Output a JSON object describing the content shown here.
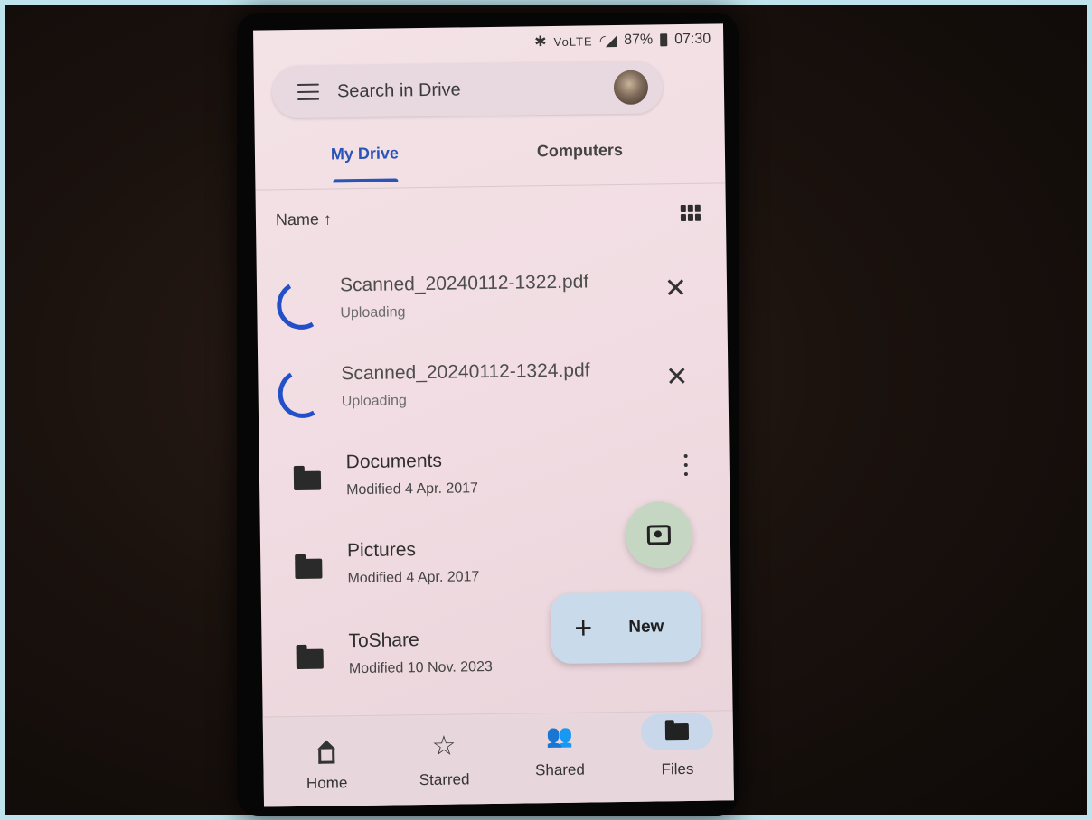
{
  "status_bar": {
    "network": "VoLTE",
    "battery": "87%",
    "time": "07:30"
  },
  "search": {
    "placeholder": "Search in Drive"
  },
  "tabs": [
    {
      "label": "My Drive",
      "active": true
    },
    {
      "label": "Computers",
      "active": false
    }
  ],
  "sort": {
    "label": "Name ↑"
  },
  "uploads": [
    {
      "name": "Scanned_20240112-1322.pdf",
      "status": "Uploading"
    },
    {
      "name": "Scanned_20240112-1324.pdf",
      "status": "Uploading"
    }
  ],
  "folders": [
    {
      "name": "Documents",
      "modified": "Modified 4 Apr. 2017"
    },
    {
      "name": "Pictures",
      "modified": "Modified 4 Apr. 2017"
    },
    {
      "name": "ToShare",
      "modified": "Modified 10 Nov. 2023"
    }
  ],
  "fab": {
    "new_label": "New"
  },
  "bottom_nav": [
    {
      "label": "Home"
    },
    {
      "label": "Starred"
    },
    {
      "label": "Shared"
    },
    {
      "label": "Files"
    }
  ],
  "colors": {
    "accent": "#2a55b8",
    "spinner": "#2350c8",
    "fab_new_bg": "#c9daeb",
    "fab_camera_bg": "#c5d6c2"
  }
}
